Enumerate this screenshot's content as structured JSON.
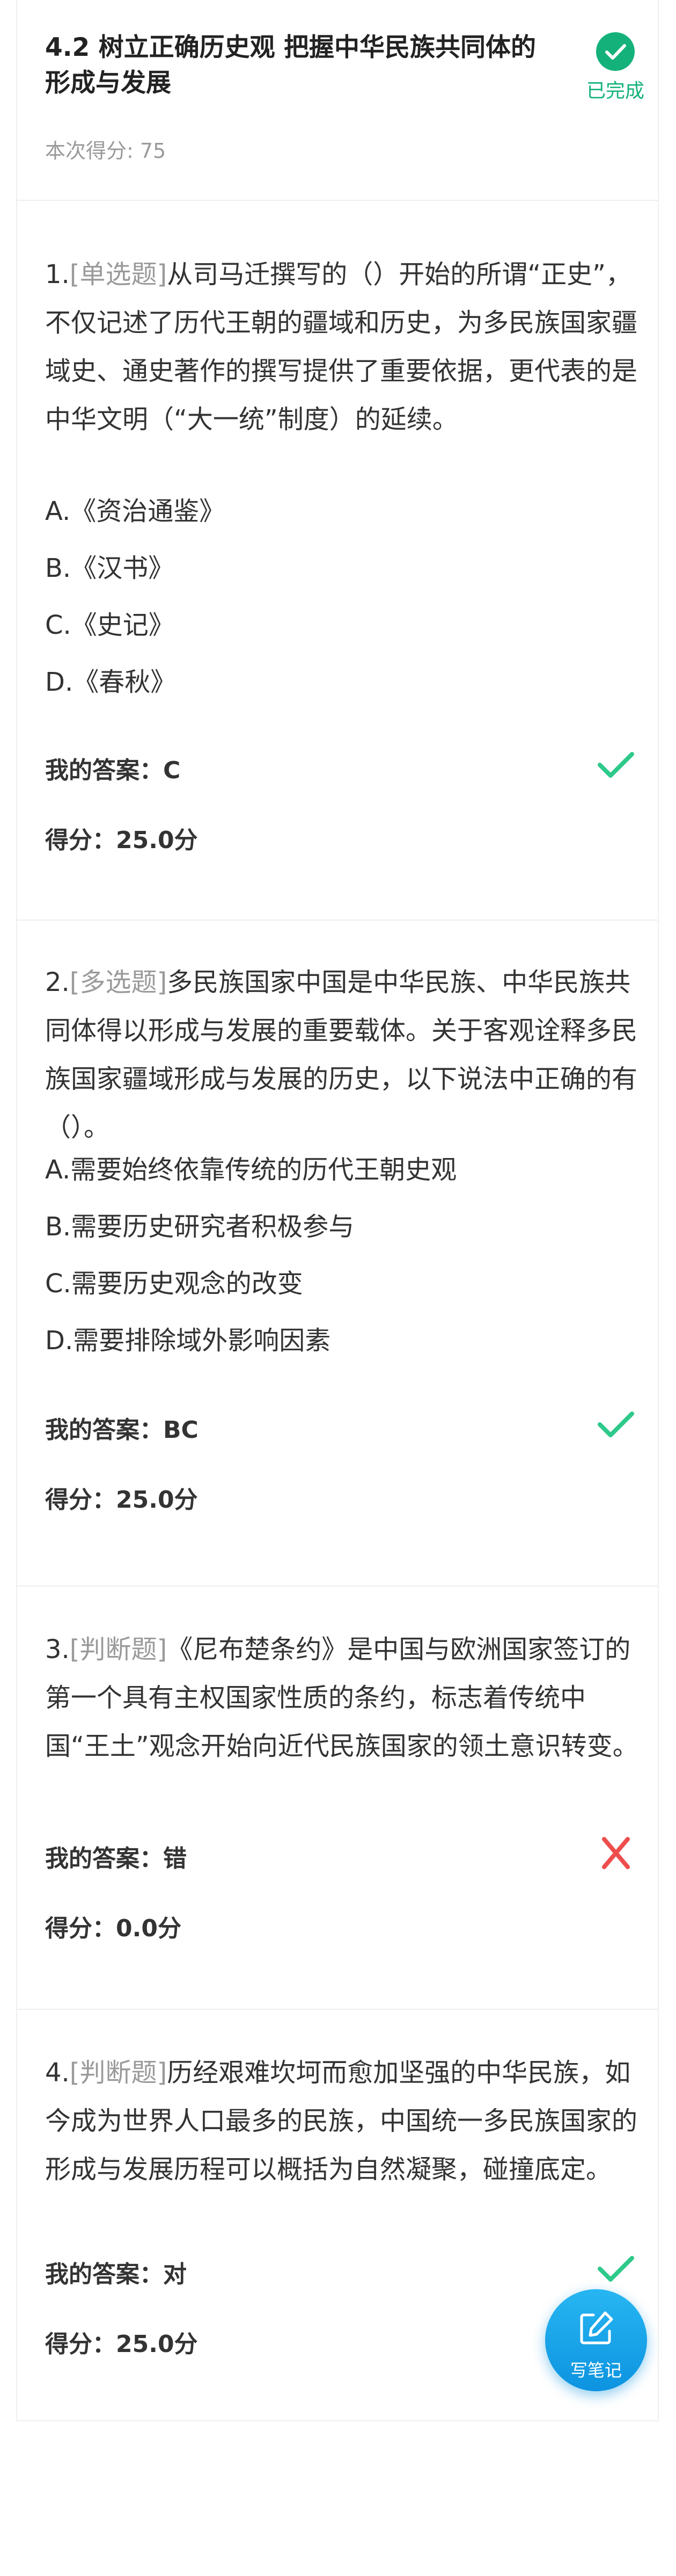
{
  "header": {
    "title": "4.2 树立正确历史观 把握中华民族共同体的形成与发展",
    "status_label": "已完成",
    "score_line": "本次得分: 75"
  },
  "questions": [
    {
      "number": "1.",
      "type": "[单选题]",
      "stem": "从司马迁撰写的（）开始的所谓“正史”，不仅记述了历代王朝的疆域和历史，为多民族国家疆域史、通史著作的撰写提供了重要依据，更代表的是中华文明（“大一统”制度）的延续。",
      "options": [
        "A.《资治通鉴》",
        "B.《汉书》",
        "C.《史记》",
        "D.《春秋》"
      ],
      "my_answer": "我的答案：C",
      "score": "得分：25.0分",
      "result": "correct"
    },
    {
      "number": "2.",
      "type": "[多选题]",
      "stem": "多民族国家中国是中华民族、中华民族共同体得以形成与发展的重要载体。关于客观诠释多民族国家疆域形成与发展的历史，以下说法中正确的有（）。",
      "options": [
        "A.需要始终依靠传统的历代王朝史观",
        "B.需要历史研究者积极参与",
        "C.需要历史观念的改变",
        "D.需要排除域外影响因素"
      ],
      "my_answer": "我的答案：BC",
      "score": "得分：25.0分",
      "result": "correct"
    },
    {
      "number": "3.",
      "type": "[判断题]",
      "stem": "《尼布楚条约》是中国与欧洲国家签订的第一个具有主权国家性质的条约，标志着传统中国“王土”观念开始向近代民族国家的领土意识转变。",
      "options": [],
      "my_answer": "我的答案：错",
      "score": "得分：0.0分",
      "result": "wrong"
    },
    {
      "number": "4.",
      "type": "[判断题]",
      "stem": "历经艰难坎坷而愈加坚强的中华民族，如今成为世界人口最多的民族，中国统一多民族国家的形成与发展历程可以概括为自然凝聚，碰撞底定。",
      "options": [],
      "my_answer": "我的答案：对",
      "score": "得分：25.0分",
      "result": "correct"
    }
  ],
  "fab": {
    "label": "写笔记",
    "icon": "edit-note-icon",
    "color": "#1aa7ec"
  },
  "colors": {
    "correct": "#2ec98b",
    "wrong": "#ee4d4d",
    "done": "#14b27a"
  }
}
